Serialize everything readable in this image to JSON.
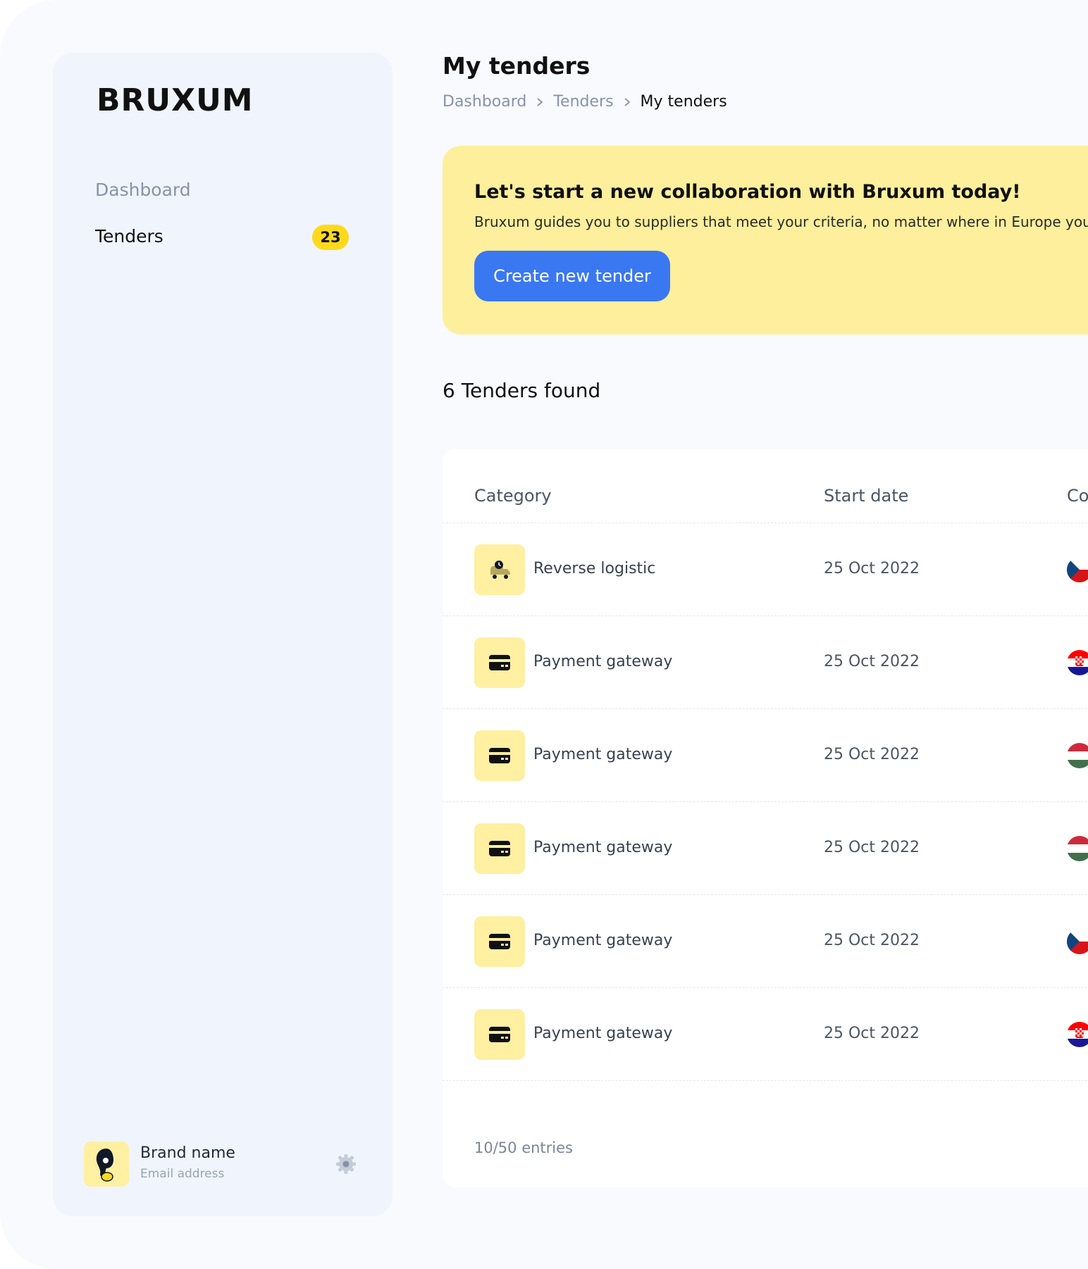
{
  "brand": {
    "logo": "BRUXUM"
  },
  "sidebar": {
    "items": [
      {
        "label": "Dashboard"
      },
      {
        "label": "Tenders",
        "badge": "23"
      }
    ],
    "user": {
      "name": "Brand name",
      "email": "Email address"
    }
  },
  "header": {
    "title": "My tenders",
    "breadcrumb": [
      "Dashboard",
      "Tenders",
      "My tenders"
    ]
  },
  "banner": {
    "title": "Let's start a new collaboration with Bruxum today!",
    "text": "Bruxum guides you to suppliers that meet your criteria, no matter where in Europe you",
    "button_label": "Create new tender"
  },
  "results": {
    "count_label": "6 Tenders found"
  },
  "table": {
    "columns": [
      "Category",
      "Start date",
      "Co"
    ],
    "rows": [
      {
        "category": "Reverse logistic",
        "start_date": "25 Oct 2022",
        "icon": "truck-icon",
        "flag": "czech-flag"
      },
      {
        "category": "Payment gateway",
        "start_date": "25 Oct 2022",
        "icon": "credit-card-icon",
        "flag": "croatia-flag"
      },
      {
        "category": "Payment gateway",
        "start_date": "25 Oct 2022",
        "icon": "credit-card-icon",
        "flag": "hungary-flag"
      },
      {
        "category": "Payment gateway",
        "start_date": "25 Oct 2022",
        "icon": "credit-card-icon",
        "flag": "hungary-flag"
      },
      {
        "category": "Payment gateway",
        "start_date": "25 Oct 2022",
        "icon": "credit-card-icon",
        "flag": "czech-flag"
      },
      {
        "category": "Payment gateway",
        "start_date": "25 Oct 2022",
        "icon": "credit-card-icon",
        "flag": "croatia-flag"
      }
    ],
    "footer": "10/50 entries"
  },
  "colors": {
    "accent": "#3a78f2",
    "badge": "#ffd91c",
    "banner": "#feef9c",
    "icon_bg": "#fff0a2"
  }
}
